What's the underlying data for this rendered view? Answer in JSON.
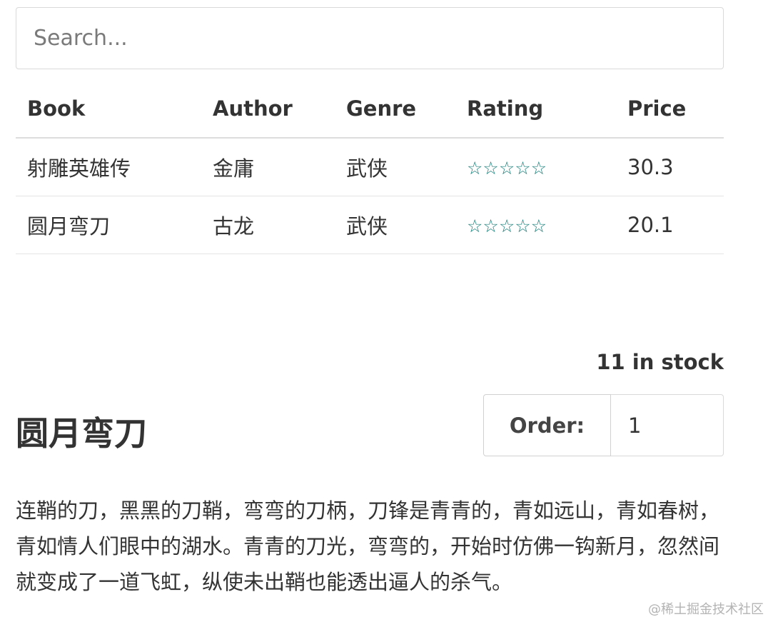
{
  "search": {
    "placeholder": "Search...",
    "value": ""
  },
  "table": {
    "headers": {
      "book": "Book",
      "author": "Author",
      "genre": "Genre",
      "rating": "Rating",
      "price": "Price"
    },
    "rows": [
      {
        "book": "射雕英雄传",
        "author": "金庸",
        "genre": "武侠",
        "rating": "☆☆☆☆☆",
        "price": "30.3"
      },
      {
        "book": "圆月弯刀",
        "author": "古龙",
        "genre": "武侠",
        "rating": "☆☆☆☆☆",
        "price": "20.1"
      }
    ]
  },
  "details": {
    "stock": "11 in stock",
    "title": "圆月弯刀",
    "order_label": "Order:",
    "order_quantity": "1",
    "description": "连鞘的刀，黑黑的刀鞘，弯弯的刀柄，刀锋是青青的，青如远山，青如春树，青如情人们眼中的湖水。青青的刀光，弯弯的，开始时仿佛一钩新月，忽然间就变成了一道飞虹，纵使未出鞘也能透出逼人的杀气。"
  },
  "watermark": "@稀土掘金技术社区",
  "colors": {
    "star": "#1a7f7a",
    "text": "#333333",
    "border": "#d9d9d9"
  },
  "icons": {
    "rating_star": "outline-star-icon"
  }
}
